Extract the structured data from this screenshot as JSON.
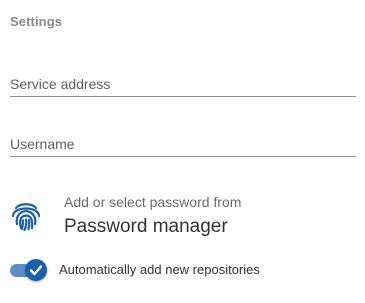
{
  "settings": {
    "title": "Settings"
  },
  "fields": {
    "service_address": {
      "placeholder": "Service address",
      "value": ""
    },
    "username": {
      "placeholder": "Username",
      "value": ""
    }
  },
  "password_manager": {
    "line1": "Add or select password from",
    "line2": "Password manager",
    "icon": "fingerprint-icon"
  },
  "auto_add": {
    "label": "Automatically add new repositories",
    "enabled": true
  },
  "colors": {
    "accent": "#1a5fa8",
    "track": "#5a8fc5",
    "title_gray": "#8a8a8a"
  }
}
